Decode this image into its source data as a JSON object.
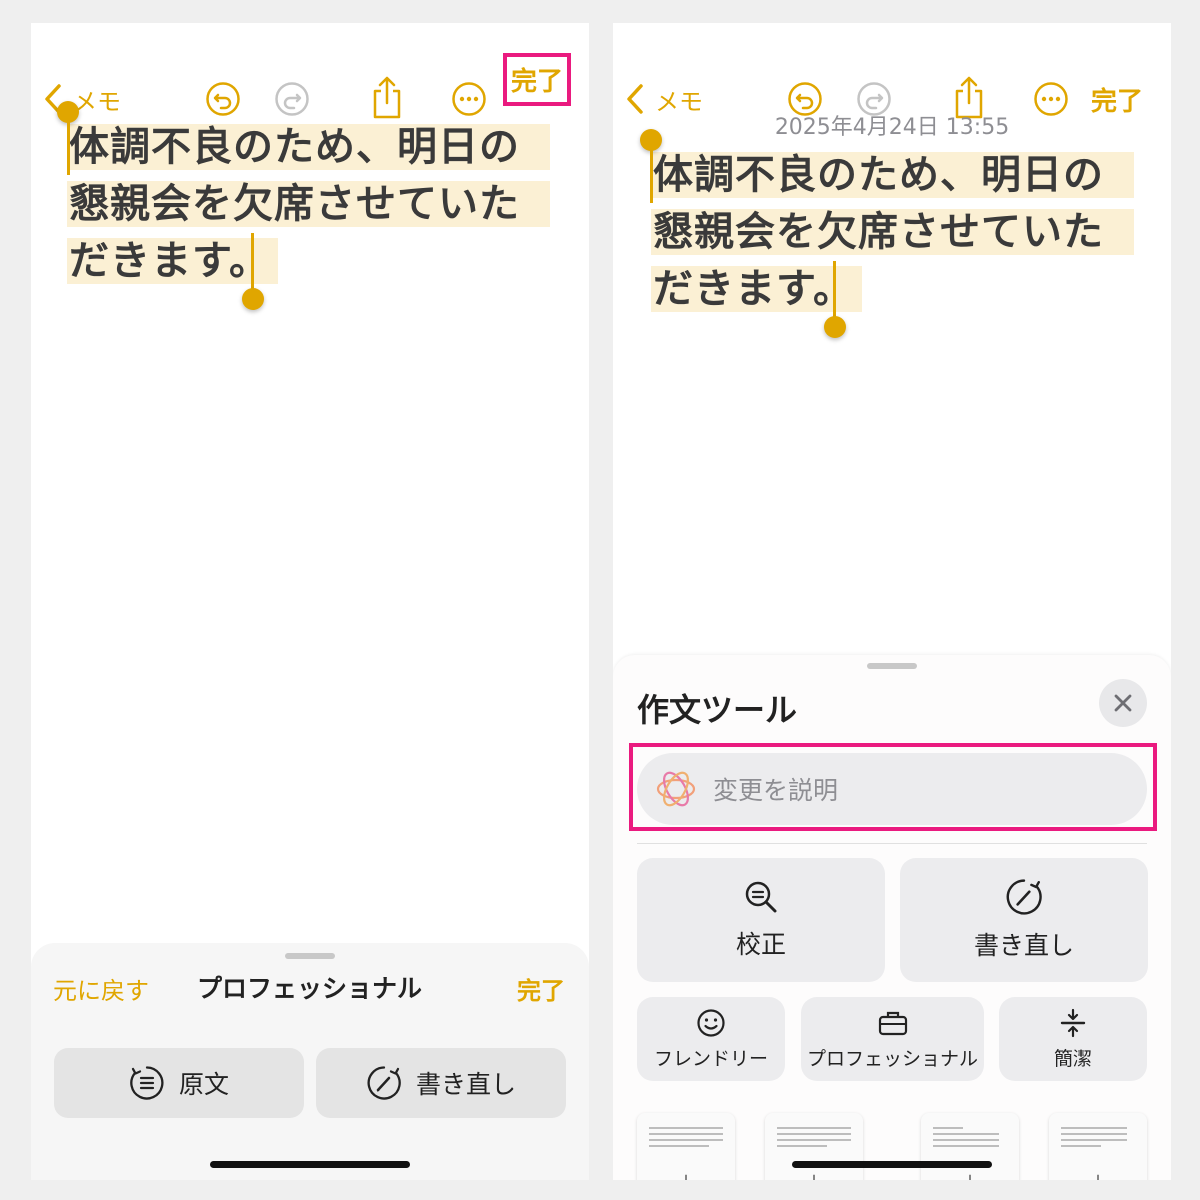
{
  "left": {
    "nav": {
      "back_label": "メモ",
      "done_label": "完了"
    },
    "note": {
      "lines": [
        "体調不良のため、明日の",
        "懇親会を欠席させていた",
        "だきます。"
      ]
    },
    "panel": {
      "undo_label": "元に戻す",
      "title": "プロフェッショナル",
      "done_label": "完了",
      "original_label": "原文",
      "rewrite_label": "書き直し"
    }
  },
  "right": {
    "nav": {
      "back_label": "メモ",
      "done_label": "完了"
    },
    "timestamp": "2025年4月24日 13:55",
    "note": {
      "lines": [
        "体調不良のため、明日の",
        "懇親会を欠席させていた",
        "だきます。"
      ]
    },
    "sheet": {
      "title": "作文ツール",
      "prompt_placeholder": "変更を説明",
      "proofread_label": "校正",
      "rewrite_label": "書き直し",
      "friendly_label": "フレンドリー",
      "professional_label": "プロフェッショナル",
      "concise_label": "簡潔"
    }
  },
  "colors": {
    "accent": "#e0a600",
    "highlight_box": "#ea1a7f",
    "selection": "#fbf0d4"
  },
  "icons": [
    "chevron-left-icon",
    "undo-icon",
    "redo-icon",
    "share-icon",
    "more-icon",
    "close-icon",
    "apple-intelligence-icon",
    "magnifier-icon",
    "rewrite-icon",
    "smile-icon",
    "briefcase-icon",
    "concise-icon",
    "original-text-icon"
  ]
}
